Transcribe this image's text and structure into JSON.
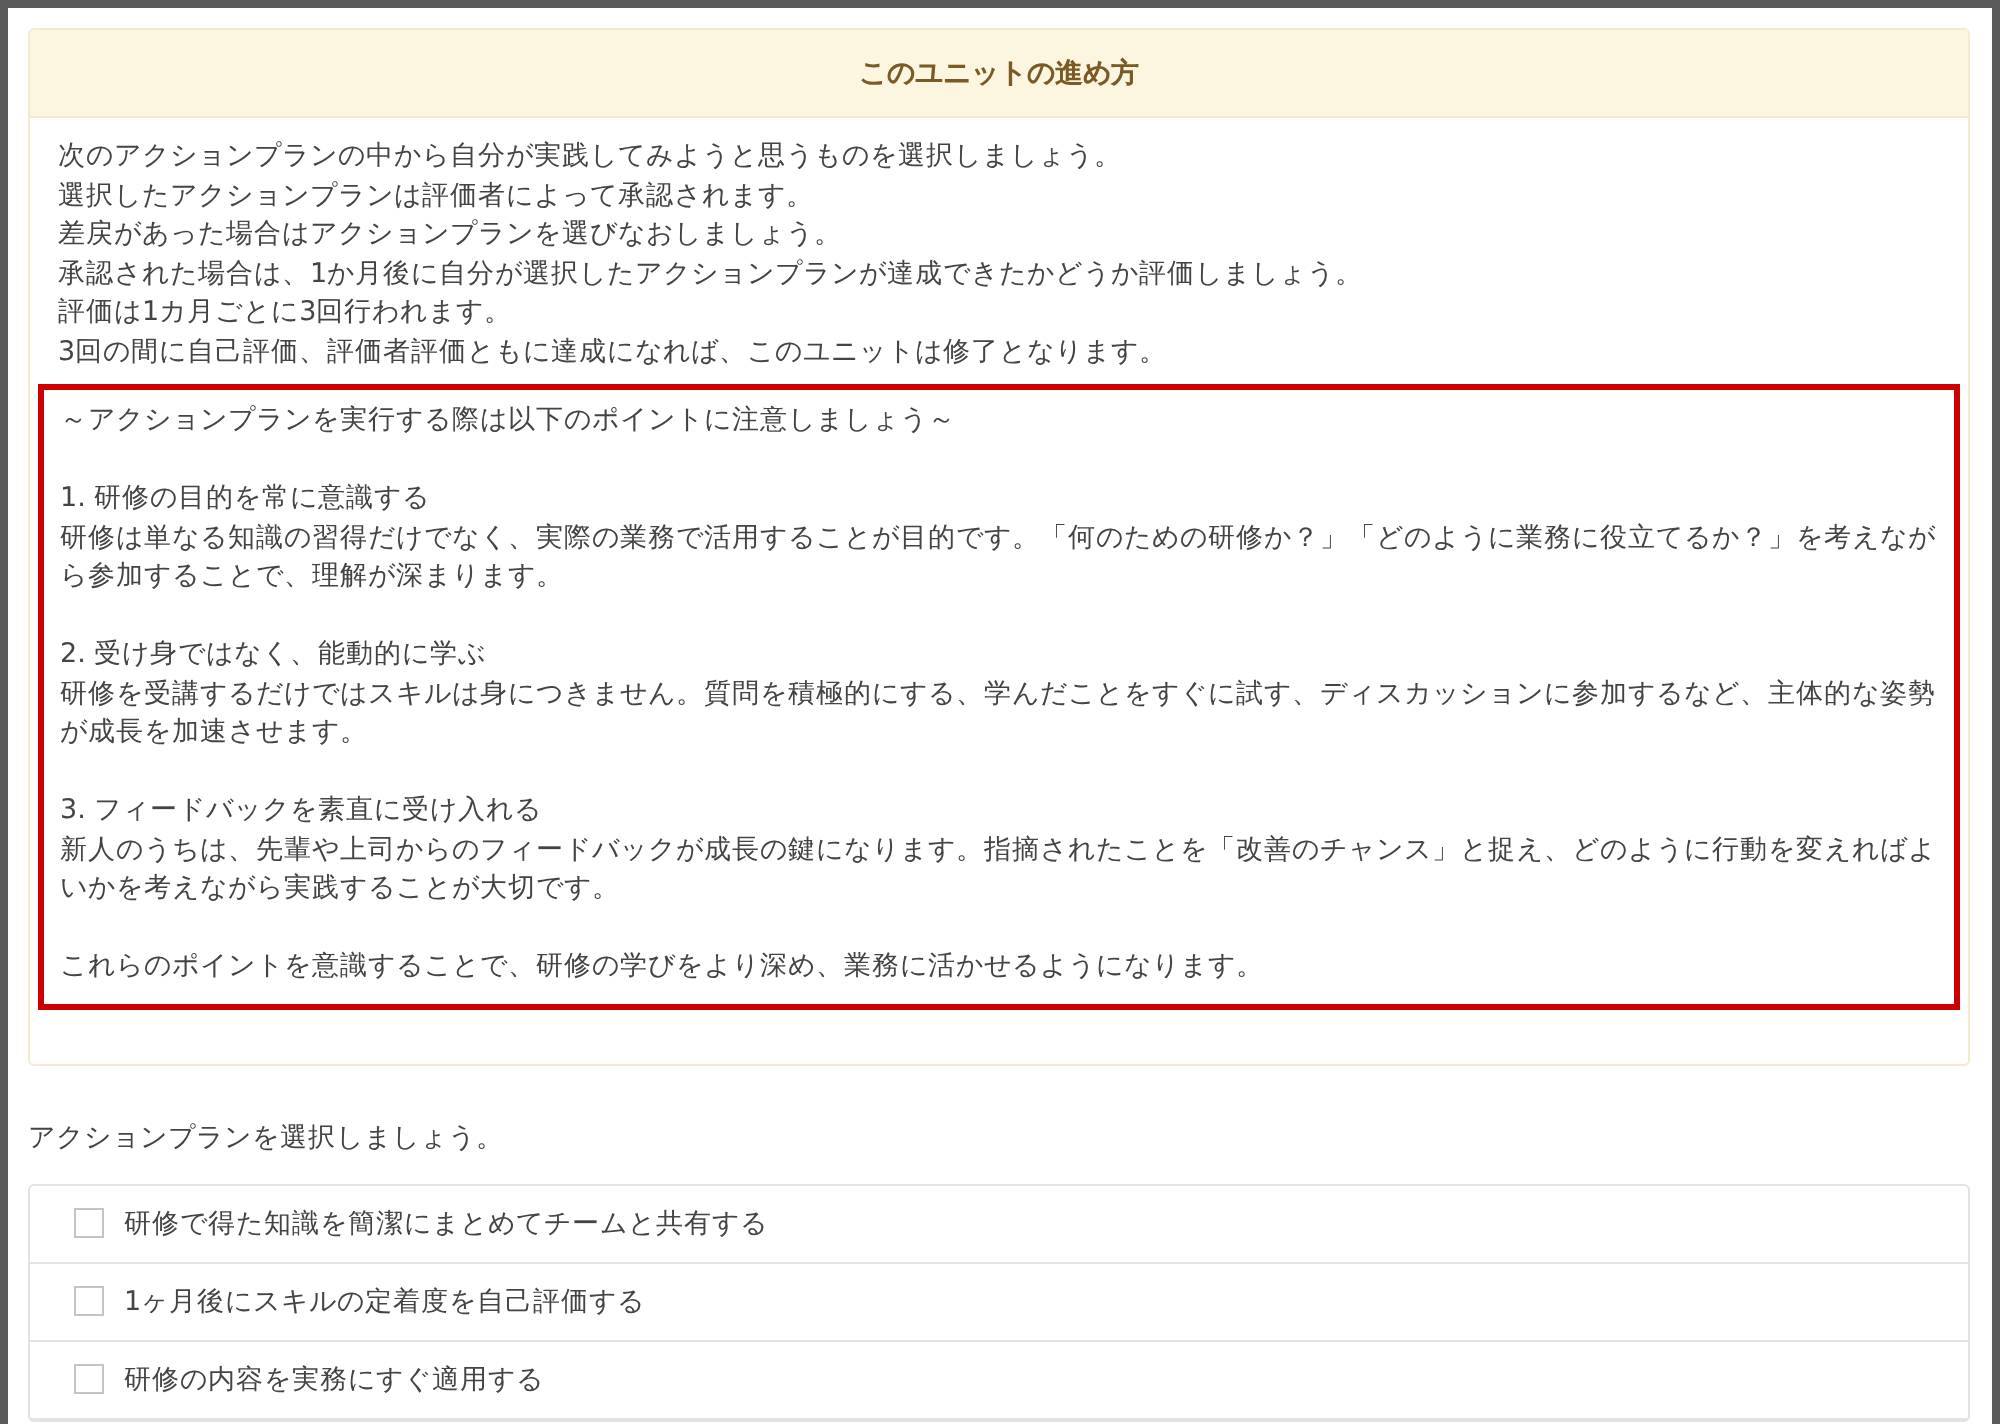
{
  "unit_guide": {
    "title": "このユニットの進め方",
    "intro_lines": [
      "次のアクションプランの中から自分が実践してみようと思うものを選択しましょう。",
      "選択したアクションプランは評価者によって承認されます。",
      "差戻があった場合はアクションプランを選びなおしましょう。",
      "承認された場合は、1か月後に自分が選択したアクションプランが達成できたかどうか評価しましょう。",
      "評価は1カ月ごとに3回行われます。",
      "3回の間に自己評価、評価者評価ともに達成になれば、このユニットは修了となります。"
    ],
    "tips": {
      "heading": "～アクションプランを実行する際は以下のポイントに注意しましょう～",
      "points": [
        {
          "title": "1. 研修の目的を常に意識する",
          "body": "研修は単なる知識の習得だけでなく、実際の業務で活用することが目的です。「何のための研修か？」「どのように業務に役立てるか？」を考えながら参加することで、理解が深まります。"
        },
        {
          "title": "2. 受け身ではなく、能動的に学ぶ",
          "body": "研修を受講するだけではスキルは身につきません。質問を積極的にする、学んだことをすぐに試す、ディスカッションに参加するなど、主体的な姿勢が成長を加速させます。"
        },
        {
          "title": "3. フィードバックを素直に受け入れる",
          "body": "新人のうちは、先輩や上司からのフィードバックが成長の鍵になります。指摘されたことを「改善のチャンス」と捉え、どのように行動を変えればよいかを考えながら実践することが大切です。"
        }
      ],
      "closing": "これらのポイントを意識することで、研修の学びをより深め、業務に活かせるようになります。"
    }
  },
  "action_plans": {
    "prompt": "アクションプランを選択しましょう。",
    "items": [
      {
        "label": "研修で得た知識を簡潔にまとめてチームと共有する",
        "checked": false
      },
      {
        "label": "1ヶ月後にスキルの定着度を自己評価する",
        "checked": false
      },
      {
        "label": "研修の内容を実務にすぐ適用する",
        "checked": false
      }
    ]
  }
}
